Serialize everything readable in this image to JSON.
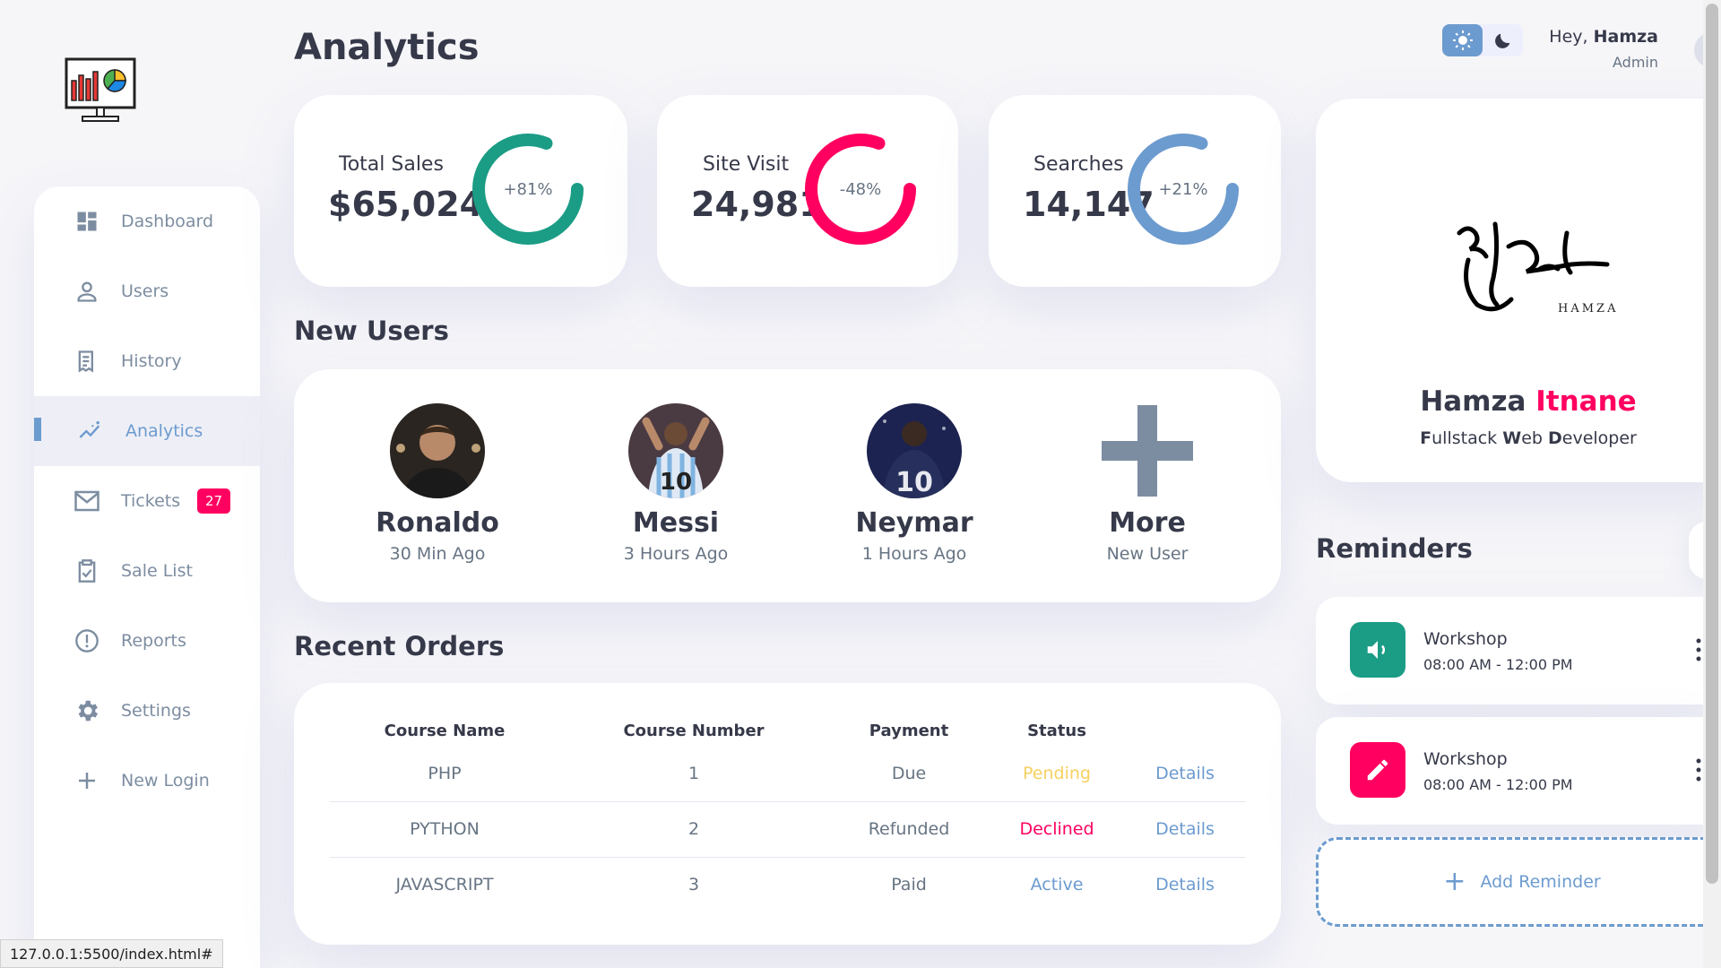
{
  "header": {
    "title": "Analytics"
  },
  "nav": {
    "theme": {
      "light_icon": "sun-icon",
      "dark_icon": "moon-icon"
    },
    "greeting_prefix": "Hey, ",
    "user_name": "Hamza",
    "role": "Admin"
  },
  "sidebar": {
    "items": [
      {
        "label": "Dashboard",
        "icon": "grid-icon"
      },
      {
        "label": "Users",
        "icon": "person-icon"
      },
      {
        "label": "History",
        "icon": "receipt-icon"
      },
      {
        "label": "Analytics",
        "icon": "insights-icon",
        "active": true
      },
      {
        "label": "Tickets",
        "icon": "mail-icon",
        "count": "27"
      },
      {
        "label": "Sale List",
        "icon": "clipboard-check-icon"
      },
      {
        "label": "Reports",
        "icon": "alert-circle-icon"
      },
      {
        "label": "Settings",
        "icon": "gear-icon"
      },
      {
        "label": "New Login",
        "icon": "plus-icon"
      }
    ]
  },
  "stats": [
    {
      "label": "Total Sales",
      "value": "$65,024",
      "percent": "+81%",
      "fill": 0.81,
      "color": "#1b9c85"
    },
    {
      "label": "Site Visit",
      "value": "24,981",
      "percent": "-48%",
      "fill": 0.81,
      "color": "#ff0060"
    },
    {
      "label": "Searches",
      "value": "14,147",
      "percent": "+21%",
      "fill": 0.81,
      "color": "#6c9bcf"
    }
  ],
  "new_users": {
    "title": "New Users",
    "users": [
      {
        "name": "Ronaldo",
        "time": "30 Min Ago"
      },
      {
        "name": "Messi",
        "time": "3 Hours Ago"
      },
      {
        "name": "Neymar",
        "time": "1 Hours Ago"
      },
      {
        "name": "More",
        "time": "New User"
      }
    ]
  },
  "recent_orders": {
    "title": "Recent Orders",
    "columns": [
      "Course Name",
      "Course Number",
      "Payment",
      "Status"
    ],
    "rows": [
      {
        "course": "PHP",
        "number": "1",
        "payment": "Due",
        "status": "Pending",
        "status_kind": "warning",
        "action": "Details"
      },
      {
        "course": "PYTHON",
        "number": "2",
        "payment": "Refunded",
        "status": "Declined",
        "status_kind": "danger",
        "action": "Details"
      },
      {
        "course": "JAVASCRIPT",
        "number": "3",
        "payment": "Paid",
        "status": "Active",
        "status_kind": "primary",
        "action": "Details"
      }
    ]
  },
  "profile": {
    "signature_text": "HAMZA",
    "first_name": "Hamza",
    "last_name": "Itnane",
    "role_parts": [
      {
        "bold": "F",
        "rest": "ullstack "
      },
      {
        "bold": "W",
        "rest": "eb "
      },
      {
        "bold": "D",
        "rest": "eveloper"
      }
    ]
  },
  "reminders": {
    "title": "Reminders",
    "items": [
      {
        "title": "Workshop",
        "time": "08:00 AM - 12:00 PM",
        "icon": "volume-icon",
        "color": "#1b9c85"
      },
      {
        "title": "Workshop",
        "time": "08:00 AM - 12:00 PM",
        "icon": "edit-icon",
        "color": "#ff0060"
      }
    ],
    "add_label": "Add Reminder"
  },
  "browser": {
    "status_url": "127.0.0.1:5500/index.html#"
  }
}
